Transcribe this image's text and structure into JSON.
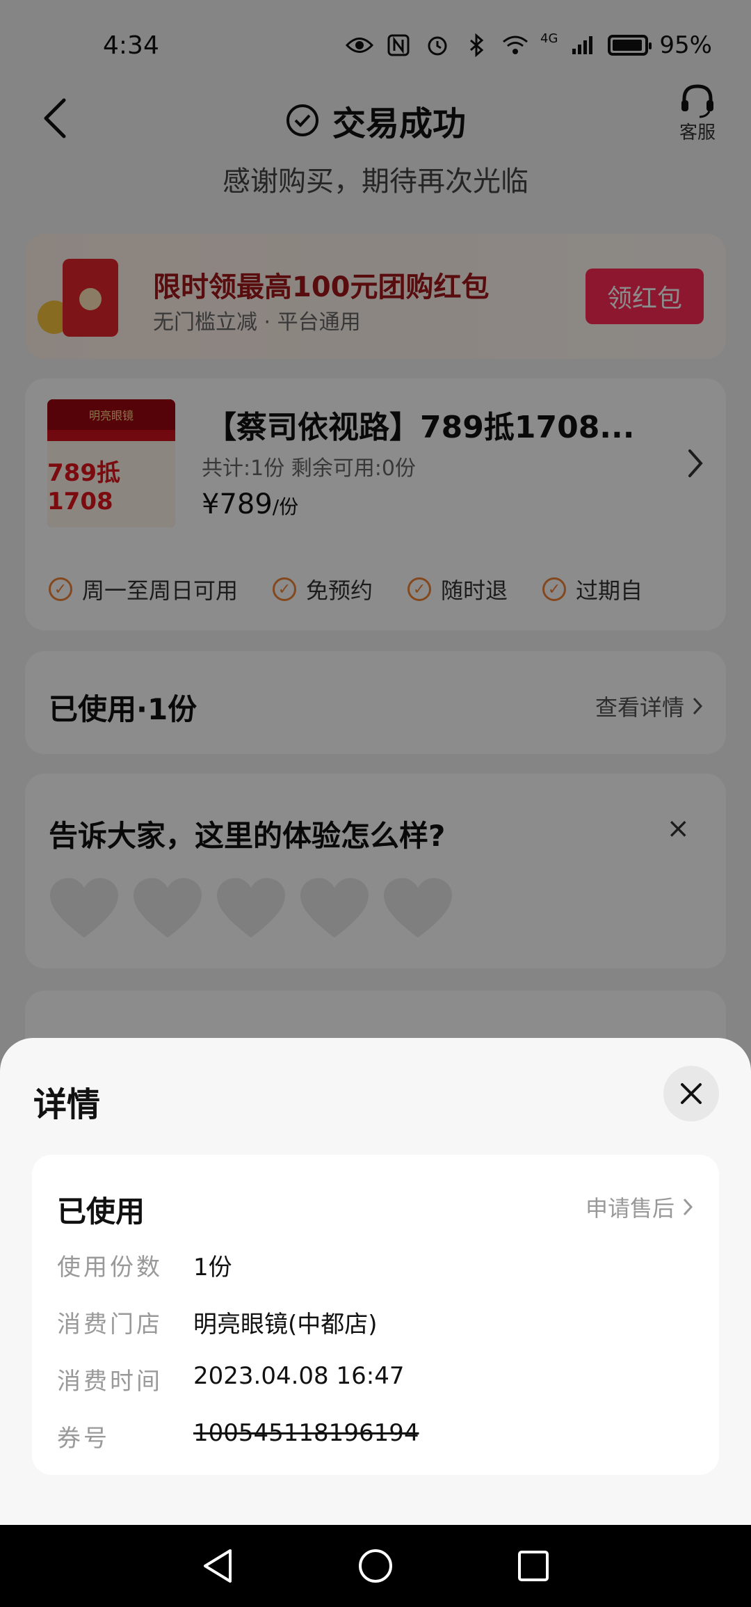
{
  "status_bar": {
    "time": "4:34",
    "network": "4G",
    "battery": "95%"
  },
  "header": {
    "title": "交易成功",
    "subtitle": "感谢购买，期待再次光临",
    "service_label": "客服"
  },
  "promo": {
    "title": "限时领最高100元团购红包",
    "subtitle": "无门槛立减 · 平台通用",
    "button": "领红包"
  },
  "product": {
    "title": "【蔡司依视路】789抵1708...",
    "meta": "共计:1份  剩余可用:0份",
    "price": "¥789",
    "price_unit": "/份",
    "thumb_brand": "明亮眼镜",
    "thumb_headline": "789抵1708",
    "tags": [
      "周一至周日可用",
      "免预约",
      "随时退",
      "过期自"
    ]
  },
  "used_section": {
    "label": "已使用·1份",
    "link": "查看详情"
  },
  "review": {
    "question": "告诉大家，这里的体验怎么样?",
    "close": "×",
    "heart_count": 5
  },
  "sheet": {
    "title": "详情",
    "status": "已使用",
    "aftersale": "申请售后",
    "rows": [
      {
        "key": "使用份数",
        "value": "1份"
      },
      {
        "key": "消费门店",
        "value": "明亮眼镜(中都店)"
      },
      {
        "key": "消费时间",
        "value": "2023.04.08 16:47"
      },
      {
        "key": "券号",
        "value": "100545118196194"
      }
    ]
  },
  "icons": {
    "back": "back-arrow-icon",
    "check": "check-circle-icon",
    "headset": "headset-icon",
    "close": "close-icon",
    "chevron": "chevron-right-icon",
    "heart": "heart-icon"
  },
  "colors": {
    "accent": "#ff2b55",
    "tag_orange": "#f0833a",
    "promo_text": "#a1161a"
  }
}
